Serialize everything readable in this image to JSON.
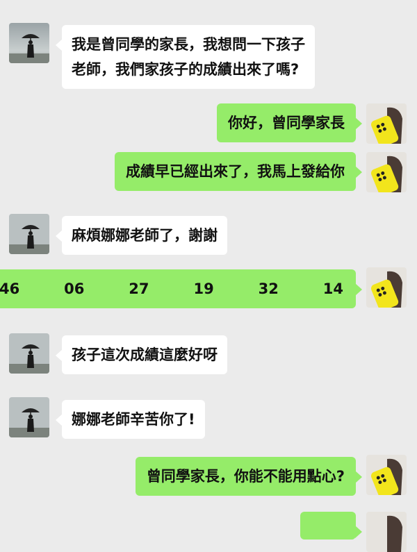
{
  "messages": [
    {
      "side": "in",
      "lines": [
        "我是曾同學的家長，我想問一下孩子",
        "老師，我們家孩子的成績出來了嗎?"
      ]
    },
    {
      "side": "out",
      "text": "你好，曾同學家長"
    },
    {
      "side": "out",
      "text": "成績早已經出來了，我馬上發給你"
    },
    {
      "side": "in",
      "text": "麻煩娜娜老師了，謝謝"
    },
    {
      "side": "out",
      "text": "46   06   27   19   32   14"
    },
    {
      "side": "in",
      "text": "孩子這次成績這麼好呀"
    },
    {
      "side": "in",
      "text": "娜娜老師辛苦你了!"
    },
    {
      "side": "out",
      "text": "曾同學家長，你能不能用點心?"
    },
    {
      "side": "out",
      "text": ""
    }
  ],
  "colors": {
    "background": "#ebebeb",
    "incoming_bubble": "#ffffff",
    "outgoing_bubble": "#95ec69"
  },
  "icons": {
    "incoming_avatar": "person-with-umbrella-icon",
    "outgoing_avatar": "yellow-phone-icon"
  }
}
